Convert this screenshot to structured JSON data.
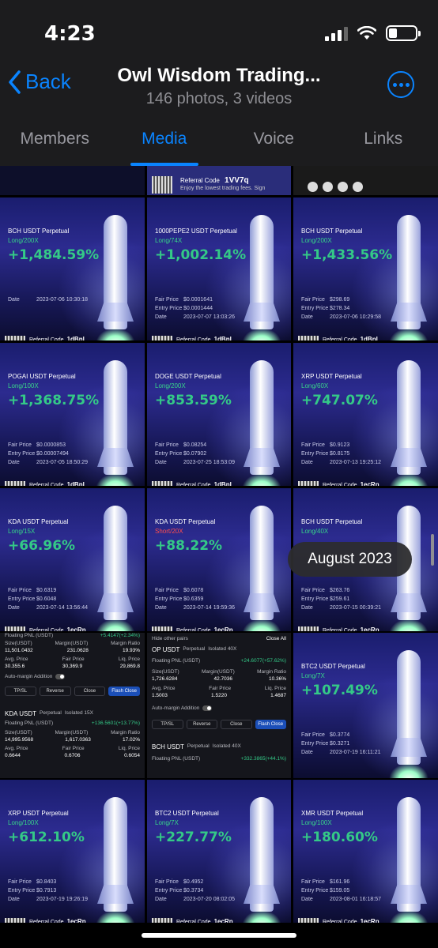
{
  "status": {
    "time": "4:23",
    "battery_level": 0.3
  },
  "header": {
    "back_label": "Back",
    "title": "Owl Wisdom Trading...",
    "subtitle": "146 photos, 3 videos"
  },
  "tabs": [
    {
      "label": "Members",
      "active": false
    },
    {
      "label": "Media",
      "active": true
    },
    {
      "label": "Voice",
      "active": false
    },
    {
      "label": "Links",
      "active": false
    }
  ],
  "top_strip": {
    "referral_label": "Referral Code",
    "referral_code": "1VV7q",
    "fee_text": "Enjoy the lowest trading fees. Sign"
  },
  "tiles": [
    {
      "symbol": "BCH USDT Perpetual",
      "leverage": "Long/200X",
      "pct": "+1,484.59%",
      "fair": "",
      "entry": "",
      "date": "2023-07-06 10:30:18",
      "code": "1dBnL"
    },
    {
      "symbol": "1000PEPE2 USDT Perpetual",
      "leverage": "Long/74X",
      "pct": "+1,002.14%",
      "fair": "$0.0001641",
      "entry": "$0.0001444",
      "date": "2023-07-07 13:03:26",
      "code": "1dBnL"
    },
    {
      "symbol": "BCH USDT Perpetual",
      "leverage": "Long/200X",
      "pct": "+1,433.56%",
      "fair": "$298.69",
      "entry": "$278.34",
      "date": "2023-07-06 10:29:58",
      "code": "1dBnL"
    },
    {
      "symbol": "POGAI USDT Perpetual",
      "leverage": "Long/100X",
      "pct": "+1,368.75%",
      "fair": "$0.0000853",
      "entry": "$0.00007494",
      "date": "2023-07-05 18:50:29",
      "code": "1dBnL"
    },
    {
      "symbol": "DOGE USDT Perpetual",
      "leverage": "Long/200X",
      "pct": "+853.59%",
      "fair": "$0.08254",
      "entry": "$0.07902",
      "date": "2023-07-25 18:53:09",
      "code": "1dBnL"
    },
    {
      "symbol": "XRP USDT Perpetual",
      "leverage": "Long/60X",
      "pct": "+747.07%",
      "fair": "$0.9123",
      "entry": "$0.8175",
      "date": "2023-07-13 19:25:12",
      "code": "1ecRn"
    },
    {
      "symbol": "KDA USDT Perpetual",
      "leverage": "Long/15X",
      "pct": "+66.96%",
      "fair": "$0.6319",
      "entry": "$0.6048",
      "date": "2023-07-14 13:56:44",
      "code": "1ecRn"
    },
    {
      "symbol": "KDA USDT Perpetual",
      "leverage": "Short/20X",
      "pct": "+88.22%",
      "fair": "$0.6078",
      "entry": "$0.6359",
      "date": "2023-07-14 19:59:36",
      "code": "1ecRn"
    },
    {
      "symbol": "BCH USDT Perpetual",
      "leverage": "Long/40X",
      "pct": "",
      "fair": "$263.76",
      "entry": "$259.61",
      "date": "2023-07-15 00:39:21",
      "code": "1ecRn"
    },
    {
      "symbol": "BTC2 USDT Perpetual",
      "leverage": "Long/7X",
      "pct": "+107.49%",
      "fair": "$0.3774",
      "entry": "$0.3271",
      "date": "2023-07-19 16:11:21",
      "code": ""
    },
    {
      "symbol": "XRP USDT Perpetual",
      "leverage": "Long/100X",
      "pct": "+612.10%",
      "fair": "$0.8403",
      "entry": "$0.7913",
      "date": "2023-07-19 19:26:19",
      "code": "1ecRn"
    },
    {
      "symbol": "BTC2 USDT Perpetual",
      "leverage": "Long/7X",
      "pct": "+227.77%",
      "fair": "$0.4952",
      "entry": "$0.3734",
      "date": "2023-07-20 08:02:05",
      "code": "1ecRn"
    },
    {
      "symbol": "XMR USDT Perpetual",
      "leverage": "Long/100X",
      "pct": "+180.60%",
      "fair": "$161.96",
      "entry": "$159.05",
      "date": "2023-08-01 16:18:57",
      "code": "1ecRn"
    }
  ],
  "tile_labels": {
    "fair_price": "Fair Price",
    "entry_price": "Entry Price",
    "date": "Date",
    "referral": "Referral Code",
    "fee_text": "Enjoy the lowest trading fees. Sign up now!"
  },
  "pnl1": {
    "floating": "Floating PNL (USDT)",
    "floating_val": "+5.4147(+2.34%)",
    "size_val": "11,501.0432",
    "margin_val": "231.0628",
    "ratio_val": "19.93%",
    "avg_val": "30.355.6",
    "fair_val": "30,369.9",
    "liq_val": "29,869.8",
    "avg": "Avg. Price",
    "fair": "Fair Price",
    "liq": "Liq. Price",
    "size": "Size(USDT)",
    "margin": "Margin(USDT)",
    "ratio": "Margin Ratio",
    "auto": "Auto-margin Addition",
    "tpsl": "TP/SL",
    "reverse": "Reverse",
    "close": "Close",
    "flash": "Flash Close",
    "sym2": "KDA USDT",
    "sym2_tag": "Perpetual",
    "iso2": "Isolated 15X",
    "floating2_val": "+136.5601(+13.77%)",
    "size2_val": "14,995.9568",
    "margin2_val": "1,617.0363",
    "ratio2_val": "17.02%",
    "avg2_val": "0.6644",
    "fair2_val": "0.6706",
    "liq2_val": "0.6054"
  },
  "pnl2": {
    "hide": "Hide other pairs",
    "close_all": "Close All",
    "sym": "OP USDT",
    "sym_tag": "Perpetual",
    "iso": "Isolated 40X",
    "floating": "Floating PNL (USDT)",
    "floating_val": "+24.6077(+57.62%)",
    "size": "Size(USDT)",
    "margin": "Margin(USDT)",
    "ratio": "Margin Ratio",
    "size_val": "1,726.6284",
    "margin_val": "42.7036",
    "ratio_val": "10.36%",
    "avg": "Avg. Price",
    "fair": "Fair Price",
    "liq": "Liq. Price",
    "avg_val": "1.5003",
    "fair_val": "1.5220",
    "liq_val": "1.4687",
    "auto": "Auto-margin Addition",
    "tpsl": "TP/SL",
    "reverse": "Reverse",
    "close": "Close",
    "flash": "Flash Close",
    "sym2": "BCH USDT",
    "sym2_tag": "Perpetual",
    "iso2": "Isolated 40X",
    "floating2_val": "+332.3865(+44.1%)"
  },
  "scroll_date": "August 2023",
  "colors": {
    "accent": "#0a84ff",
    "gain": "#34c987",
    "loss": "#ff4d4f",
    "bar_bg": "#1c1c1e"
  }
}
